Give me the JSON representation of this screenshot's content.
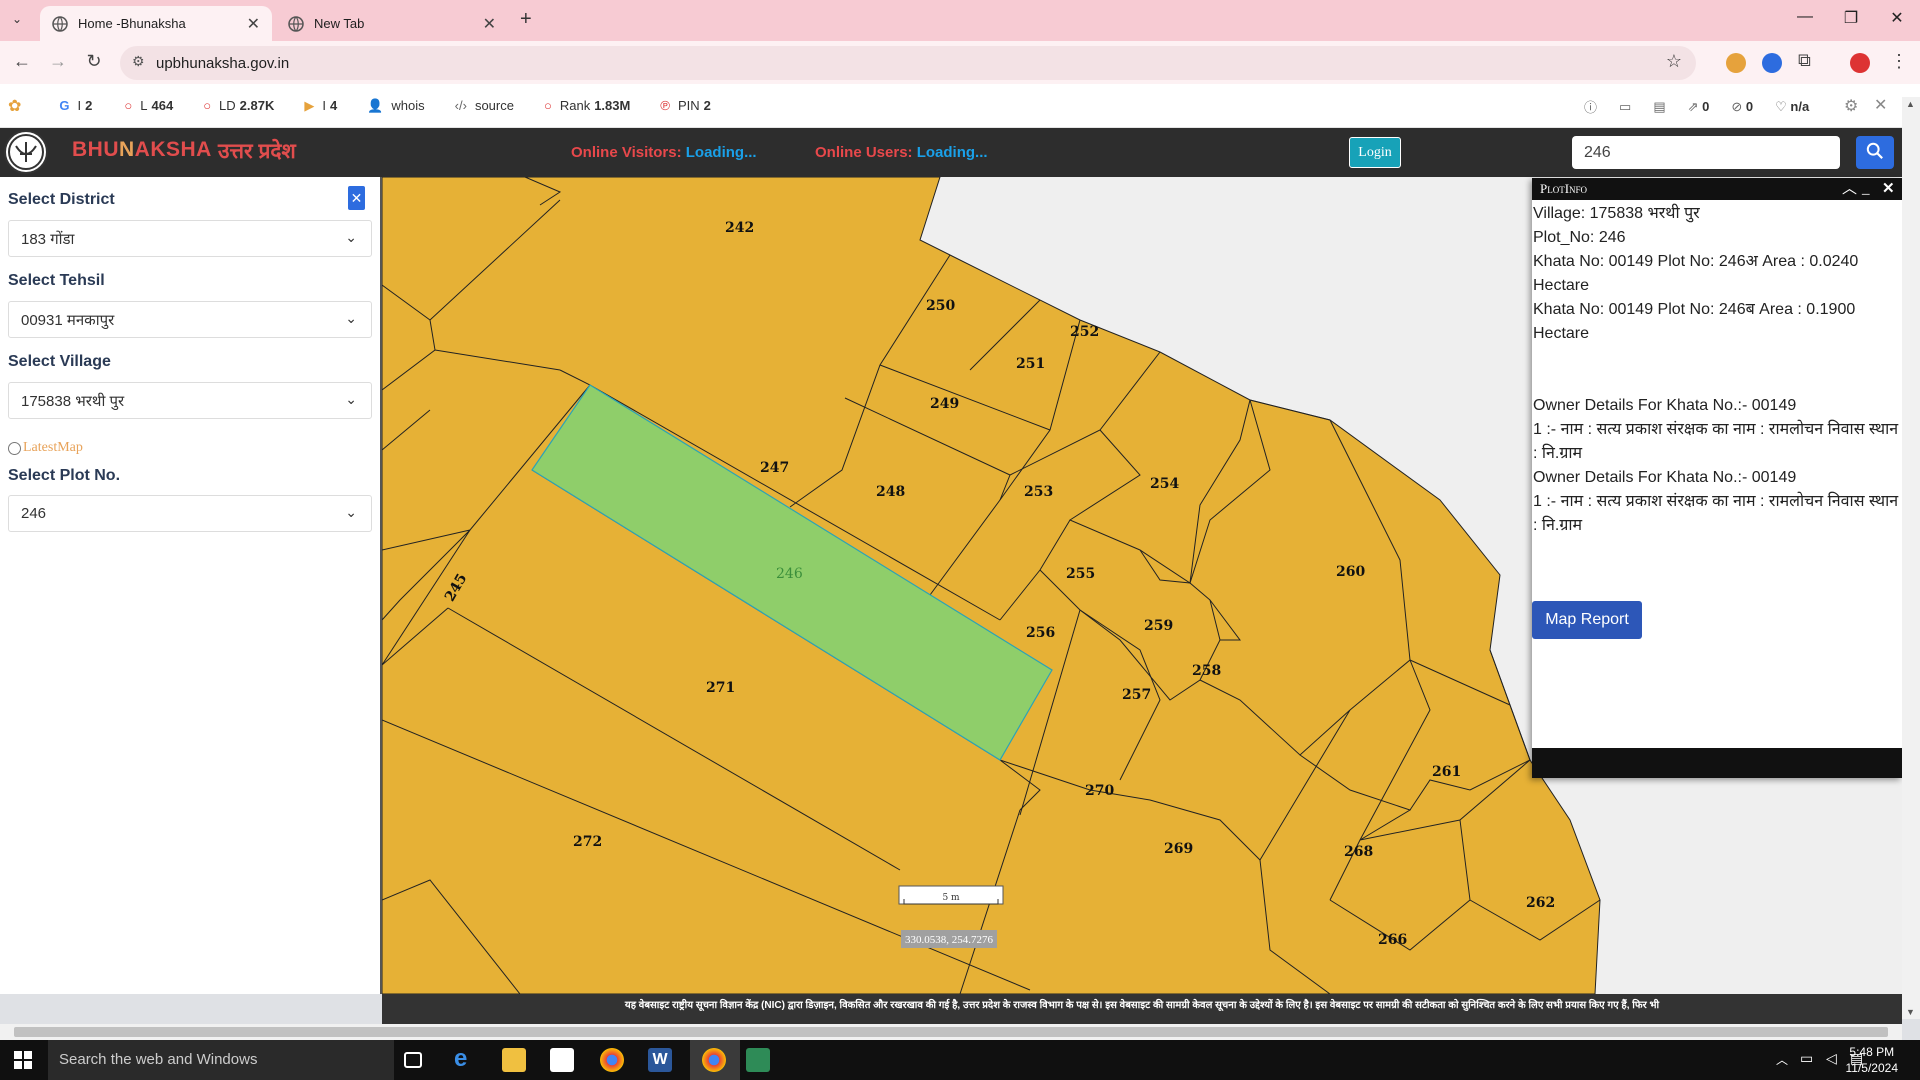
{
  "browser": {
    "tabs": [
      {
        "title": "Home -Bhunaksha",
        "active": true
      },
      {
        "title": "New Tab",
        "active": false
      }
    ],
    "url": "upbhunaksha.gov.in"
  },
  "extension_bar": {
    "items": [
      {
        "icon": "google-icon",
        "label": "I",
        "value": "2"
      },
      {
        "icon": "circle-icon",
        "label": "L",
        "value": "464"
      },
      {
        "icon": "circle-icon",
        "label": "LD",
        "value": "2.87K"
      },
      {
        "icon": "bing-icon",
        "label": "I",
        "value": "4"
      },
      {
        "icon": "user-icon",
        "label": "whois",
        "value": ""
      },
      {
        "icon": "code-icon",
        "label": "source",
        "value": ""
      },
      {
        "icon": "circle-icon",
        "label": "Rank",
        "value": "1.83M"
      },
      {
        "icon": "pinterest-icon",
        "label": "PIN",
        "value": "2"
      }
    ],
    "right": {
      "links": "0",
      "images": "0",
      "nofollow": "n/a"
    }
  },
  "site": {
    "brand_prefix": "BHU",
    "brand_u": "N",
    "brand_suffix": "AKSHA",
    "brand_hindi": "उत्तर प्रदेश",
    "online_visitors_label": "Online Visitors:",
    "online_visitors_value": "Loading...",
    "online_users_label": "Online Users:",
    "online_users_value": "Loading...",
    "login_label": "Login",
    "search_value": "246"
  },
  "left_panel": {
    "district_label": "Select District",
    "district_value": "183 गोंडा",
    "tehsil_label": "Select Tehsil",
    "tehsil_value": "00931 मनकापुर",
    "village_label": "Select Village",
    "village_value": "175838 भरथी पुर",
    "latest_map_label": "LatestMap",
    "plot_label": "Select Plot No.",
    "plot_value": "246"
  },
  "map": {
    "selected_plot": "246",
    "plots": [
      "242",
      "250",
      "252",
      "251",
      "249",
      "247",
      "248",
      "253",
      "254",
      "246",
      "245",
      "255",
      "259",
      "260",
      "256",
      "258",
      "257",
      "271",
      "270",
      "269",
      "261",
      "272",
      "268",
      "262",
      "266"
    ],
    "scale_label": "5 m",
    "coordinates": "330.0538, 254.7276",
    "colors": {
      "parcel": "#e6b136",
      "selected": "#8fce6a",
      "background": "#efefef"
    }
  },
  "plot_info": {
    "title": "PlotInfo",
    "lines": [
      "Village: 175838 भरथी पुर",
      "Plot_No: 246",
      "Khata No: 00149 Plot No: 246अ Area : 0.0240 Hectare",
      "Khata No: 00149 Plot No: 246ब Area : 0.1900 Hectare",
      "",
      "Owner Details For Khata No.:- 00149",
      "1 :- नाम : सत्य प्रकाश संरक्षक का नाम : रामलोचन निवास स्थान : नि.ग्राम",
      "Owner Details For Khata No.:- 00149",
      "1 :- नाम : सत्य प्रकाश संरक्षक का नाम : रामलोचन निवास स्थान : नि.ग्राम"
    ],
    "map_report_label": "Map Report"
  },
  "disclaimer": "यह वेबसाइट राष्ट्रीय सूचना विज्ञान केंद्र (NIC) द्वारा डिज़ाइन, विकसित और रखरखाव की गई है, उत्तर प्रदेश के राजस्व विभाग के पक्ष से। इस वेबसाइट की सामग्री केवल सूचना के उद्देश्यों के लिए है। इस वेबसाइट पर सामग्री की सटीकता को सुनिश्चित करने के लिए सभी प्रयास किए गए हैं, फिर भी",
  "taskbar": {
    "search_placeholder": "Search the web and Windows",
    "time": "5:48 PM",
    "date": "11/5/2024"
  }
}
